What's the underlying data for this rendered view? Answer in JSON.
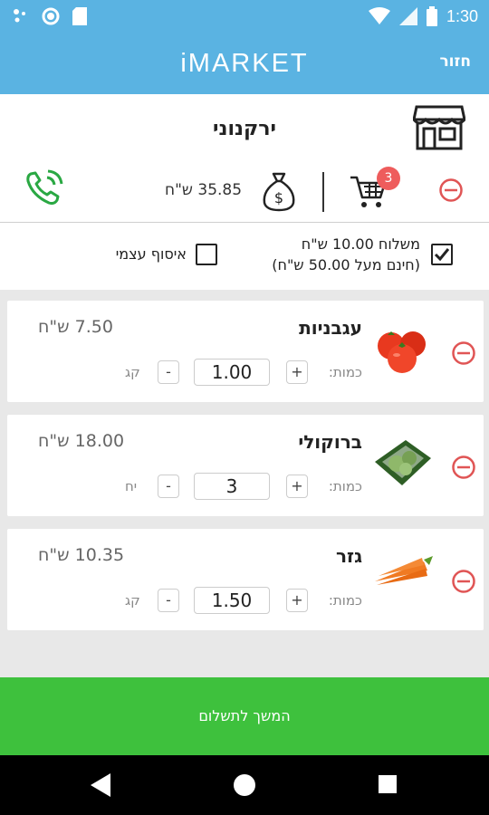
{
  "status_bar": {
    "time": "1:30"
  },
  "app_bar": {
    "title": "iMARKET",
    "back_label": "חזור"
  },
  "store": {
    "name": "ירקנוני",
    "total": "35.85 ש\"ח",
    "cart_count": "3"
  },
  "delivery": {
    "shipping_line1": "משלוח 10.00 ש\"ח",
    "shipping_line2": "(חינם מעל 50.00 ש\"ח)",
    "shipping_checked": true,
    "pickup_label": "איסוף עצמי",
    "pickup_checked": false
  },
  "cart_items": [
    {
      "name": "עגבניות",
      "price": "7.50 ש\"ח",
      "qty_label": "כמות:",
      "quantity": "1.00",
      "unit": "קג"
    },
    {
      "name": "ברוקולי",
      "price": "18.00 ש\"ח",
      "qty_label": "כמות:",
      "quantity": "3",
      "unit": "יח"
    },
    {
      "name": "גזר",
      "price": "10.35 ש\"ח",
      "qty_label": "כמות:",
      "quantity": "1.50",
      "unit": "קג"
    }
  ],
  "continue_label": "המשך לתשלום",
  "colors": {
    "primary": "#5ab3e2",
    "accent_green": "#3ec13d",
    "badge_red": "#ee5c5c",
    "remove_red": "#e05555"
  }
}
